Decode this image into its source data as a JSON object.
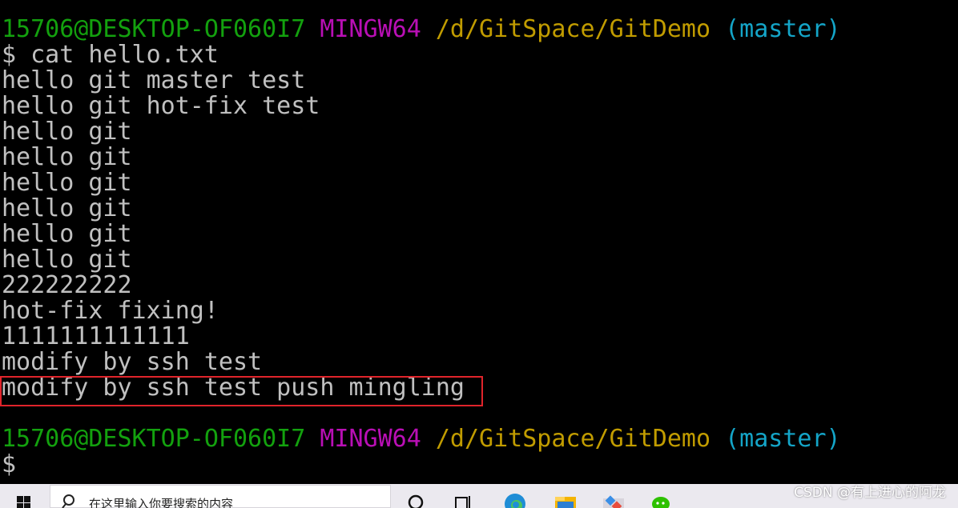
{
  "terminal": {
    "prompt1": {
      "user_host": "15706@DESKTOP-OF060I7",
      "env": "MINGW64",
      "path": "/d/GitSpace/GitDemo",
      "branch": "(master)"
    },
    "command": "$ cat hello.txt",
    "output": [
      "hello git master test",
      "hello git hot-fix test",
      "hello git",
      "hello git",
      "hello git",
      "hello git",
      "hello git",
      "hello git",
      "222222222",
      "hot-fix fixing!",
      "1111111111111",
      "modify by ssh test",
      "modify by ssh test push mingling"
    ],
    "prompt2": {
      "user_host": "15706@DESKTOP-OF060I7",
      "env": "MINGW64",
      "path": "/d/GitSpace/GitDemo",
      "branch": "(master)"
    },
    "cursor_prompt": "$"
  },
  "taskbar": {
    "search_text": "在这里输入你要搜索的内容",
    "icons": [
      "search-icon",
      "task-view-icon",
      "edge-icon",
      "file-explorer-icon",
      "git-app-icon",
      "wechat-icon"
    ]
  },
  "watermark": "CSDN @有上进心的阿龙",
  "colors": {
    "background": "#000000",
    "user_host": "#13a10e",
    "env": "#b90fb5",
    "path": "#c19c00",
    "branch": "#14a5c8",
    "text": "#c0c0c0",
    "highlight_box": "#e0242b"
  }
}
